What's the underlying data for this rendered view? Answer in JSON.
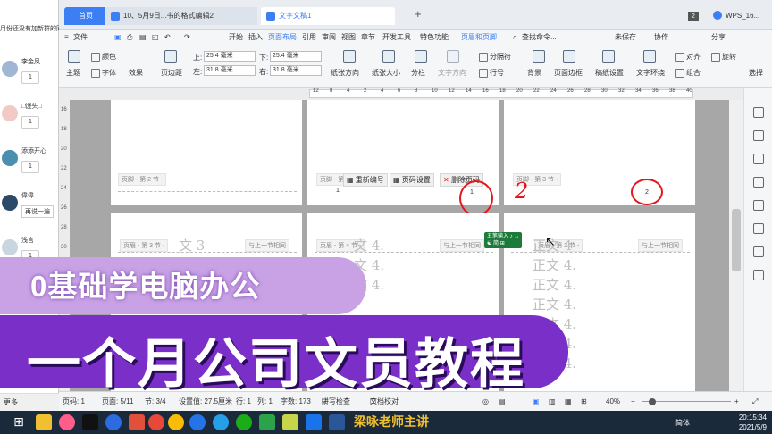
{
  "chat": {
    "notice": "月份还没有加新群的同学 下梁咏老师，加入",
    "items": [
      {
        "name": "李金凤",
        "badge": "1"
      },
      {
        "name": "□馒头□",
        "badge": "1"
      },
      {
        "name": "添添开心",
        "badge": "1"
      },
      {
        "name": "偉偉",
        "text": "再说一遍"
      },
      {
        "name": "浅言",
        "badge": "1"
      }
    ],
    "more": "更多"
  },
  "titlebar": {
    "home_tab": "首页",
    "doc_tab1": "10、5月9日...书的格式编辑2",
    "doc_tab2": "文字文稿1",
    "add_tab": "+",
    "badge_count": "2",
    "account": "WPS_16..."
  },
  "menu": {
    "file": "文件",
    "items": [
      "开始",
      "插入",
      "页面布局",
      "引用",
      "审阅",
      "视图",
      "章节",
      "开发工具",
      "特色功能",
      "页眉和页脚"
    ],
    "active": "页面布局",
    "search": "查找命令...",
    "unsaved": "未保存",
    "collab": "协作",
    "share": "分享"
  },
  "ribbon": {
    "theme": "主题",
    "color": "颜色",
    "font": "字体",
    "effect": "效果",
    "margins": "页边距",
    "top_label": "上:",
    "top_value": "25.4 毫米",
    "bottom_label": "下:",
    "bottom_value": "25.4 毫米",
    "left_label": "左:",
    "left_value": "31.8 毫米",
    "right_label": "右:",
    "right_value": "31.8 毫米",
    "orientation": "纸张方向",
    "size": "纸张大小",
    "columns": "分栏",
    "text_direction": "文字方向",
    "line_numbers": "行号",
    "breaks": "分隔符",
    "background": "背景",
    "page_border": "页面边框",
    "paper_setting": "稿纸设置",
    "text_wrap": "文字环绕",
    "align": "对齐",
    "rotate": "旋转",
    "group": "组合",
    "select": "选择"
  },
  "ruler": {
    "ticks": [
      "12",
      "8",
      "4",
      "2",
      "4",
      "6",
      "8",
      "10",
      "12",
      "14",
      "16",
      "18",
      "20",
      "22",
      "24",
      "26",
      "28",
      "30",
      "32",
      "34",
      "36",
      "38",
      "40"
    ]
  },
  "vruler": {
    "ticks": [
      "16",
      "18",
      "20",
      "22",
      "24",
      "26",
      "28",
      "30"
    ]
  },
  "doc": {
    "footer_sec2": "页脚 - 第 2 节 -",
    "footer_sec2b": "页脚 - 第 2 节 -",
    "footer_sec3": "页脚 - 第 3 节 -",
    "header_sec3": "页眉 - 第 3 节 -",
    "header_sec4": "页眉 - 第 4 节 -",
    "header_sec3b": "页眉 - 第 3 节 -",
    "same_as_prev": "与上一节相同",
    "renumber": "重新编号",
    "page_setting": "页码设置",
    "delete_page_num": "删除页码",
    "page_num_1": "1",
    "page_num_1b": "1",
    "page_num_2": "2",
    "mark_2": "2",
    "body_text_a": "文 3",
    "body_text_b": "文 4.",
    "body_text_c": "正文 4.",
    "body_text_d": "正文 4",
    "green_tip_1": "五笔输入 ♪ ↔",
    "green_tip_2": "☯ 简 ⊞"
  },
  "statusbar": {
    "page_num": "页码: 1",
    "page": "页面: 5/11",
    "section": "节: 3/4",
    "setting": "设置值: 27.5厘米",
    "row": "行: 1",
    "col": "列: 1",
    "words": "字数: 173",
    "spell": "拼写检查",
    "proof": "文档校对",
    "zoom": "40%"
  },
  "overlay": {
    "line1": "0基础学电脑办公",
    "line2": "一个月公司文员教程",
    "watermark": "梁咏老师主讲"
  },
  "taskbar": {
    "time": "20:15:34",
    "date": "2021/5/9",
    "ime": "简体"
  },
  "colors": {
    "accent": "#3c7ef3",
    "banner_light": "#c8a2e4",
    "banner_dark": "#7b2fc9",
    "annotation": "#e3161b"
  }
}
